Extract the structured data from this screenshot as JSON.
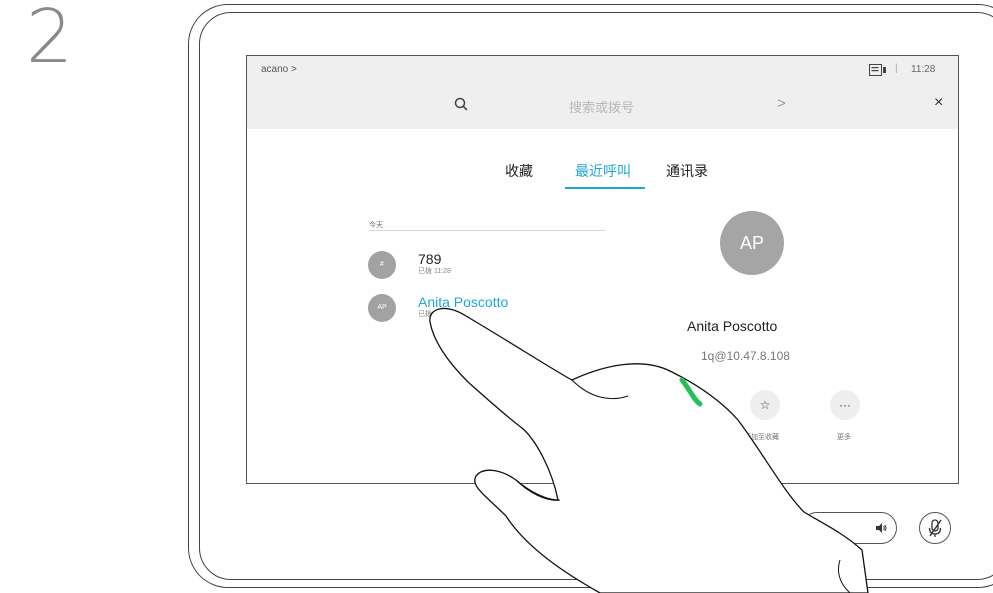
{
  "step": {
    "number": "2"
  },
  "header": {
    "breadcrumb": "acano >",
    "time_separator": "|",
    "time": "11:28",
    "camera_icon": "video-camera-icon",
    "search": {
      "placeholder": "搜索或拨号",
      "go_symbol": ">",
      "close_symbol": "×"
    }
  },
  "tabs": [
    {
      "label": "收藏",
      "active": false
    },
    {
      "label": "最近呼叫",
      "active": true
    },
    {
      "label": "通讯录",
      "active": false
    }
  ],
  "recent": {
    "section_label": "今天",
    "items": [
      {
        "avatar": "#",
        "title": "789",
        "subtitle": "已拨 11:28"
      },
      {
        "avatar": "AP",
        "title": "Anita Poscotto",
        "subtitle": "已拨"
      }
    ]
  },
  "contact": {
    "initials": "AP",
    "name": "Anita Poscotto",
    "address": "1q@10.47.8.108",
    "actions": [
      {
        "icon": "star-icon",
        "symbol": "☆",
        "label": "添加至收藏"
      },
      {
        "icon": "more-icon",
        "symbol": "···",
        "label": "更多"
      }
    ]
  },
  "controls": {
    "volume_icon": "speaker-icon",
    "mute_icon": "microphone-muted-icon"
  },
  "colors": {
    "accent": "#1ea7d6",
    "call": "#25c05a",
    "avatar": "#a5a5a5",
    "topbar": "#efefef"
  }
}
